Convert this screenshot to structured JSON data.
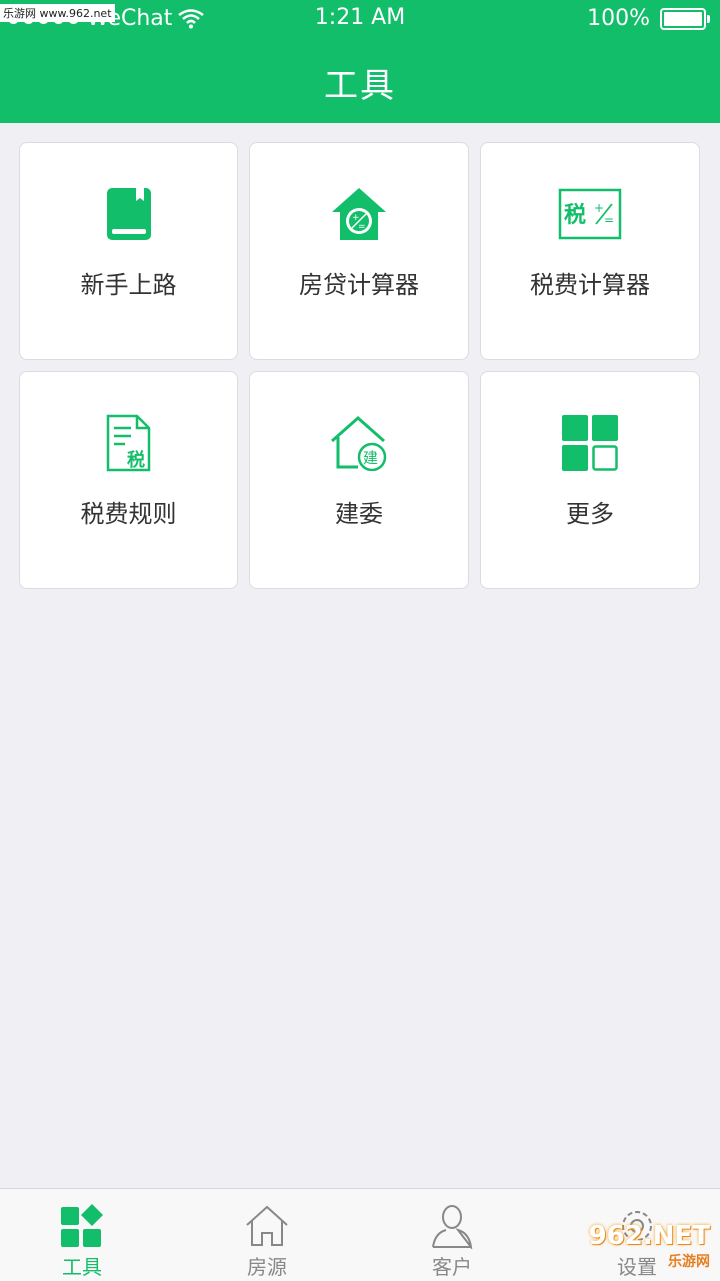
{
  "status": {
    "carrier": "WeChat",
    "time": "1:21 AM",
    "battery": "100%",
    "watermark": "乐游网 www.962.net"
  },
  "header": {
    "title": "工具"
  },
  "tools": [
    {
      "label": "新手上路",
      "icon": "book-icon"
    },
    {
      "label": "房贷计算器",
      "icon": "house-calculator-icon"
    },
    {
      "label": "税费计算器",
      "icon": "tax-calculator-icon"
    },
    {
      "label": "税费规则",
      "icon": "tax-document-icon"
    },
    {
      "label": "建委",
      "icon": "house-construction-icon"
    },
    {
      "label": "更多",
      "icon": "grid-more-icon"
    }
  ],
  "tabbar": {
    "items": [
      {
        "label": "工具",
        "icon": "tools-grid-icon",
        "active": true
      },
      {
        "label": "房源",
        "icon": "house-outline-icon",
        "active": false
      },
      {
        "label": "客户",
        "icon": "person-outline-icon",
        "active": false
      },
      {
        "label": "设置",
        "icon": "gear-icon",
        "active": false
      }
    ]
  },
  "watermark_br": {
    "main": "962.NET",
    "sub": "乐游网"
  },
  "colors": {
    "accent": "#12be6a",
    "background": "#efeff4",
    "text": "#333333",
    "tab_inactive": "#888888"
  }
}
